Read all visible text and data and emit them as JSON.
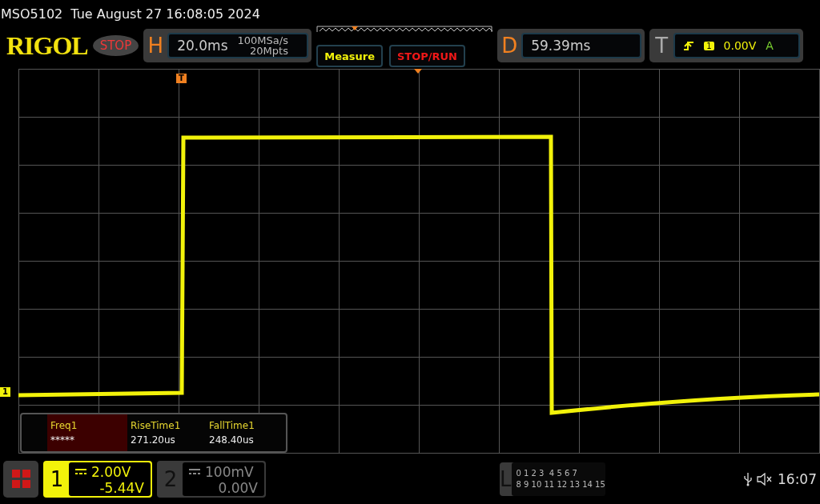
{
  "header": {
    "model": "MSO5102",
    "datetime": "Tue August 27 16:08:05 2024"
  },
  "toolbar": {
    "logo": "RIGOL",
    "run_state": "STOP",
    "horizontal": {
      "letter": "H",
      "timebase": "20.0ms",
      "sample_rate": "100MSa/s",
      "memory_depth": "20Mpts"
    },
    "buttons": [
      {
        "label": "Measure",
        "kind": "menu"
      },
      {
        "label": "STOP/RUN",
        "kind": "run"
      }
    ],
    "delay": {
      "letter": "D",
      "value": "59.39ms"
    },
    "trigger": {
      "letter": "T",
      "source": "1",
      "level": "0.00V",
      "mode": "A"
    }
  },
  "screen": {
    "channel_marker": "1",
    "trigger_position_marker": "T"
  },
  "measurements": [
    {
      "label": "Freq1",
      "value": "*****",
      "selected": true
    },
    {
      "label": "RiseTime1",
      "value": "271.20us",
      "selected": false
    },
    {
      "label": "FallTime1",
      "value": "248.40us",
      "selected": false
    }
  ],
  "channels": [
    {
      "number": "1",
      "scale": "2.00V",
      "offset": "-5.44V",
      "active": true
    },
    {
      "number": "2",
      "scale": "100mV",
      "offset": "0.00V",
      "active": false
    }
  ],
  "logic": {
    "letter": "L",
    "rows": [
      "0 1 2 3  4 5 6 7",
      "8 9 10 11 12 13 14 15"
    ]
  },
  "status": {
    "time": "16:07"
  }
}
